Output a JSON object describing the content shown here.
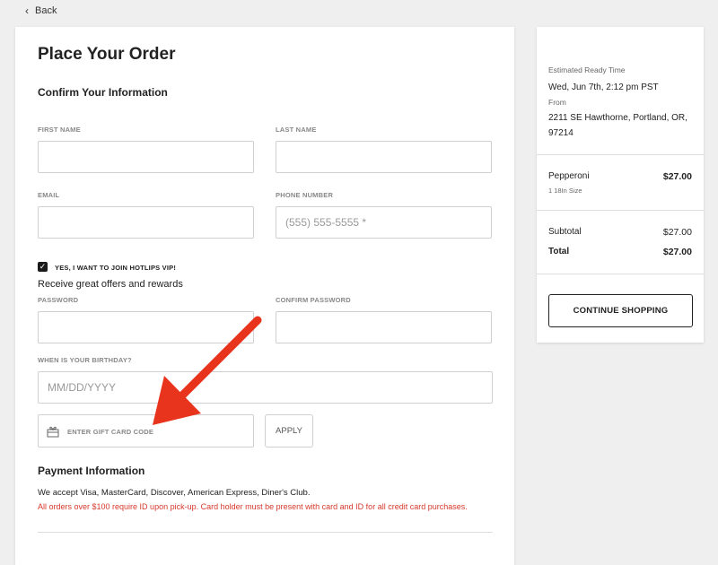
{
  "nav": {
    "back_label": "Back"
  },
  "form": {
    "title": "Place Your Order",
    "confirm_section": "Confirm Your Information",
    "first_name_label": "FIRST NAME",
    "first_name_value": "",
    "last_name_label": "LAST NAME",
    "last_name_value": "",
    "email_label": "EMAIL",
    "email_value": "",
    "phone_label": "PHONE NUMBER",
    "phone_placeholder": "(555) 555-5555 *",
    "vip_checkbox": {
      "label": "YES, I WANT TO JOIN HOTLIPS VIP!",
      "checked": true
    },
    "vip_subtext": "Receive great offers and rewards",
    "password_label": "PASSWORD",
    "confirm_password_label": "CONFIRM PASSWORD",
    "birthday_label": "WHEN IS YOUR BIRTHDAY?",
    "birthday_placeholder": "MM/DD/YYYY",
    "gift_card_placeholder": "ENTER GIFT CARD CODE",
    "apply_label": "APPLY",
    "payment_section": "Payment Information",
    "payment_text": "We accept Visa, MasterCard, Discover, American Express, Diner's Club.",
    "payment_warning": "All orders over $100 require ID upon pick-up. Card holder must be present with card and ID for all credit card purchases."
  },
  "summary": {
    "ready_label": "Estimated Ready Time",
    "ready_time": "Wed, Jun 7th, 2:12 pm PST",
    "from_label": "From",
    "address_line1": "2211 SE Hawthorne, Portland, OR,",
    "address_line2": "97214",
    "item": {
      "name": "Pepperoni",
      "price": "$27.00",
      "detail": "1  18In Size"
    },
    "subtotal_label": "Subtotal",
    "subtotal_value": "$27.00",
    "total_label": "Total",
    "total_value": "$27.00",
    "continue_label": "CONTINUE SHOPPING"
  },
  "colors": {
    "annotation_arrow": "#e8341c",
    "warning_text": "#d6392c"
  },
  "icons": {
    "back": "chevron-left-icon",
    "gift": "gift-card-icon",
    "checkbox": "checkmark-icon"
  }
}
